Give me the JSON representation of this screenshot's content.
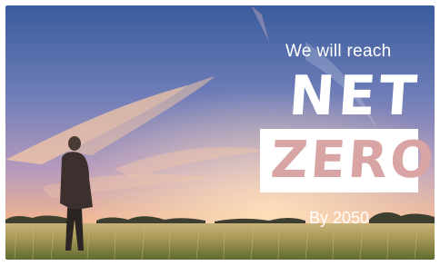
{
  "banner": {
    "tagline": "We will reach",
    "headline_top": "NET",
    "headline_bottom": "ZERO",
    "year_text": "By 2050"
  },
  "palette": {
    "sky_top": "#3b5fa0",
    "sky_mid": "#8d8ec2",
    "sky_horizon": "#f1b48c",
    "field": "#b9a664",
    "zero_text": "#d9a4a4",
    "text_white": "#ffffff"
  }
}
